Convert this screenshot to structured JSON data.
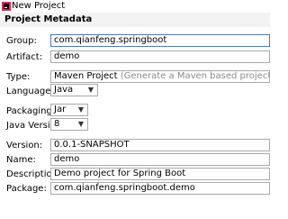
{
  "window": {
    "title": "New Project",
    "icon": "intellij-idea-icon"
  },
  "section": {
    "title": "Project Metadata"
  },
  "fields": {
    "group": {
      "label": "Group:",
      "value": "com.qianfeng.springboot"
    },
    "artifact": {
      "label": "Artifact:",
      "value": "demo"
    },
    "type": {
      "label": "Type:",
      "value": "Maven Project",
      "hint": "(Generate a Maven based project archive)"
    },
    "language": {
      "label": "Language:",
      "value": "Java"
    },
    "packaging": {
      "label": "Packaging:",
      "value": "Jar"
    },
    "javaVersion": {
      "label": "Java Version:",
      "value": "8"
    },
    "version": {
      "label": "Version:",
      "value": "0.0.1-SNAPSHOT"
    },
    "name": {
      "label": "Name:",
      "value": "demo"
    },
    "description": {
      "label": "Description:",
      "value": "Demo project for Spring Boot"
    },
    "package": {
      "label": "Package:",
      "value": "com.qianfeng.springboot.demo"
    }
  },
  "colors": {
    "accent": "#3b7dd8",
    "border": "#a9a9a9",
    "hint": "#8a8a8a",
    "section_bg": "#f3f3f3"
  }
}
